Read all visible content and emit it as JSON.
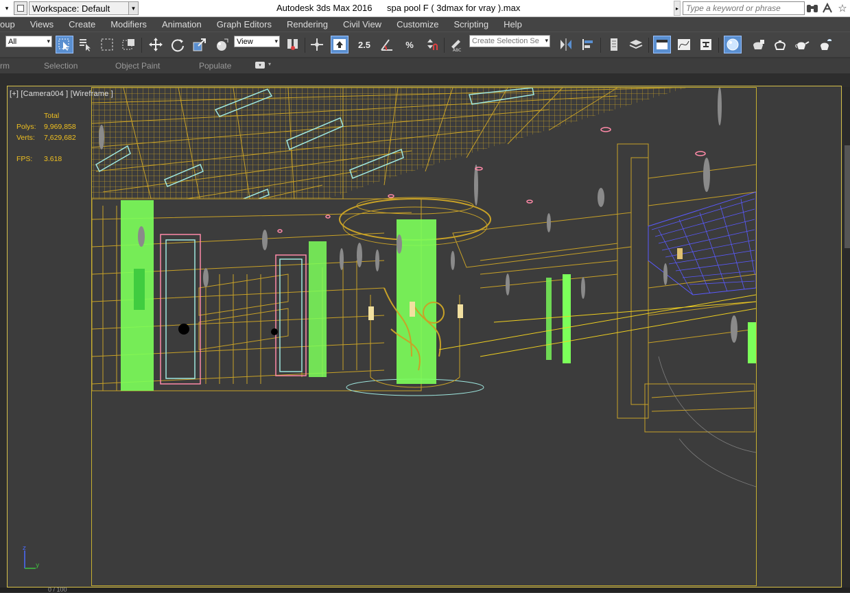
{
  "titlebar": {
    "workspace_label": "Workspace: Default",
    "app_title": "Autodesk 3ds Max 2016",
    "file_title": "spa pool F ( 3dmax for vray ).max",
    "search_placeholder": "Type a keyword or phrase"
  },
  "menu": {
    "items": [
      "oup",
      "Views",
      "Create",
      "Modifiers",
      "Animation",
      "Graph Editors",
      "Rendering",
      "Civil View",
      "Customize",
      "Scripting",
      "Help"
    ]
  },
  "toolbar": {
    "filter_value": "All",
    "coord_value": "View",
    "snap_2_5": "2.5",
    "snap_percent": "%",
    "selection_set_placeholder": "Create Selection Se"
  },
  "ribbon": {
    "tabs": [
      "rm",
      "Selection",
      "Object Paint",
      "Populate"
    ]
  },
  "viewport": {
    "label": "[+] [Camera004 ] [Wireframe ]",
    "stats": {
      "header": "Total",
      "polys_label": "Polys:",
      "polys_value": "9,969,858",
      "verts_label": "Verts:",
      "verts_value": "7,629,682",
      "fps_label": "FPS:",
      "fps_value": "3.618"
    },
    "axis": {
      "z": "z",
      "y": "y"
    }
  },
  "timeline": {
    "frame_counter": "0 / 100"
  },
  "colors": {
    "wire_gold": "#c9a227",
    "wire_green": "#7cff5a",
    "wire_blue": "#5a5aff",
    "wire_cyan": "#9fe8e0",
    "wire_pink": "#ff8aa8",
    "stats": "#f0c020",
    "active_button": "#5a8fd0"
  }
}
